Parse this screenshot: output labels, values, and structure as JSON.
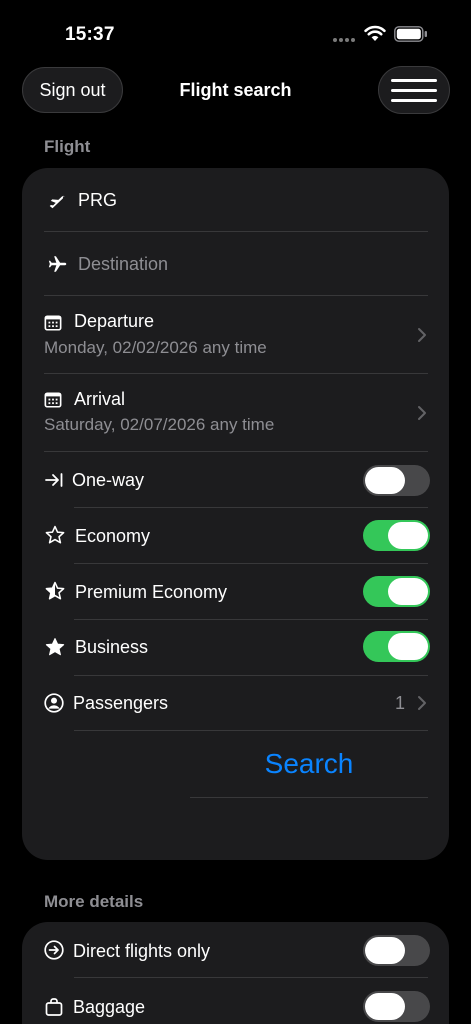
{
  "status": {
    "time": "15:37"
  },
  "nav": {
    "signout_label": "Sign out",
    "title": "Flight search"
  },
  "flight_section": {
    "header": "Flight",
    "origin": {
      "value": "PRG",
      "icon": "airplane-takeoff-icon"
    },
    "destination": {
      "placeholder": "Destination",
      "icon": "airplane-icon"
    },
    "departure": {
      "label": "Departure",
      "value": "Monday, 02/02/2026 any time"
    },
    "arrival": {
      "label": "Arrival",
      "value": "Saturday, 02/07/2026 any time"
    },
    "one_way": {
      "label": "One-way",
      "on": false
    },
    "economy": {
      "label": "Economy",
      "on": true
    },
    "premium_economy": {
      "label": "Premium Economy",
      "on": true
    },
    "business": {
      "label": "Business",
      "on": true
    },
    "passengers": {
      "label": "Passengers",
      "value": "1"
    },
    "search_label": "Search"
  },
  "more_details": {
    "header": "More details",
    "direct_flights": {
      "label": "Direct flights only",
      "on": false
    },
    "baggage": {
      "label": "Baggage",
      "on": false
    }
  },
  "colors": {
    "accent": "#0a84ff",
    "toggle_on": "#34c759",
    "card": "#1c1c1e"
  }
}
